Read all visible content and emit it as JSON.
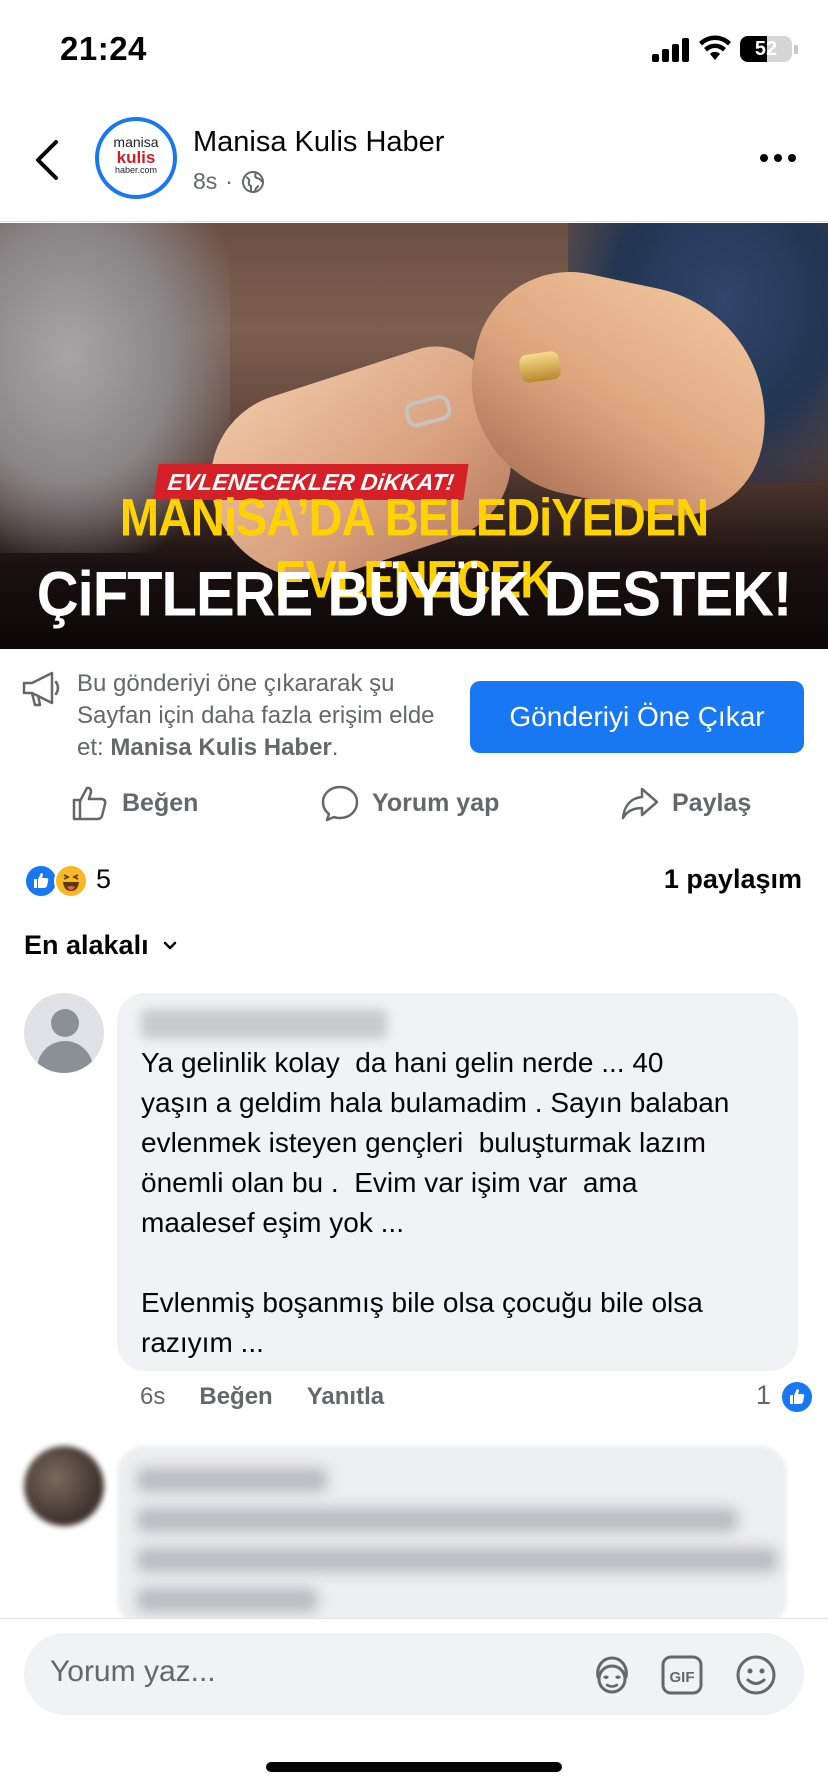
{
  "status_bar": {
    "time": "21:24",
    "battery": "52",
    "battery_level_percent": 52
  },
  "post": {
    "page_name": "Manisa Kulis Haber",
    "time": "8s",
    "separator": "·",
    "avatar_logo": {
      "line1": "manisa",
      "line2": "kulis",
      "line3": "haber.com"
    },
    "image": {
      "tag": "EVLENECEKLER DiKKAT!",
      "headline1": "MANiSA’DA BELEDiYEDEN EVLENECEK",
      "headline2": "ÇiFTLERE BÜYÜK DESTEK!"
    }
  },
  "boost": {
    "text": "Bu gönderiyi öne çıkararak şu Sayfan için daha fazla erişim elde et: ",
    "page": "Manisa Kulis Haber",
    "period": ".",
    "button": "Gönderiyi Öne Çıkar"
  },
  "actions": {
    "like": "Beğen",
    "comment": "Yorum yap",
    "share": "Paylaş"
  },
  "reactions": {
    "count": "5",
    "shares": "1 paylaşım"
  },
  "sort": {
    "label": "En alakalı"
  },
  "comment": {
    "text": "Ya gelinlik kolay  da hani gelin nerde ... 40\nyaşın a geldim hala bulamadim . Sayın balaban\nevlenmek isteyen gençleri  buluşturmak lazım\nönemli olan bu .  Evim var işim var  ama\nmaalesef eşim yok ...\n\nEvlenmiş boşanmış bile olsa çocuğu bile olsa\nrazıyım ...",
    "time": "6s",
    "like": "Beğen",
    "reply": "Yanıtla",
    "like_count": "1"
  },
  "composer": {
    "placeholder": "Yorum yaz..."
  },
  "colors": {
    "accent": "#1877f2",
    "secondary_text": "#65676b",
    "bubble": "#f0f2f5"
  }
}
